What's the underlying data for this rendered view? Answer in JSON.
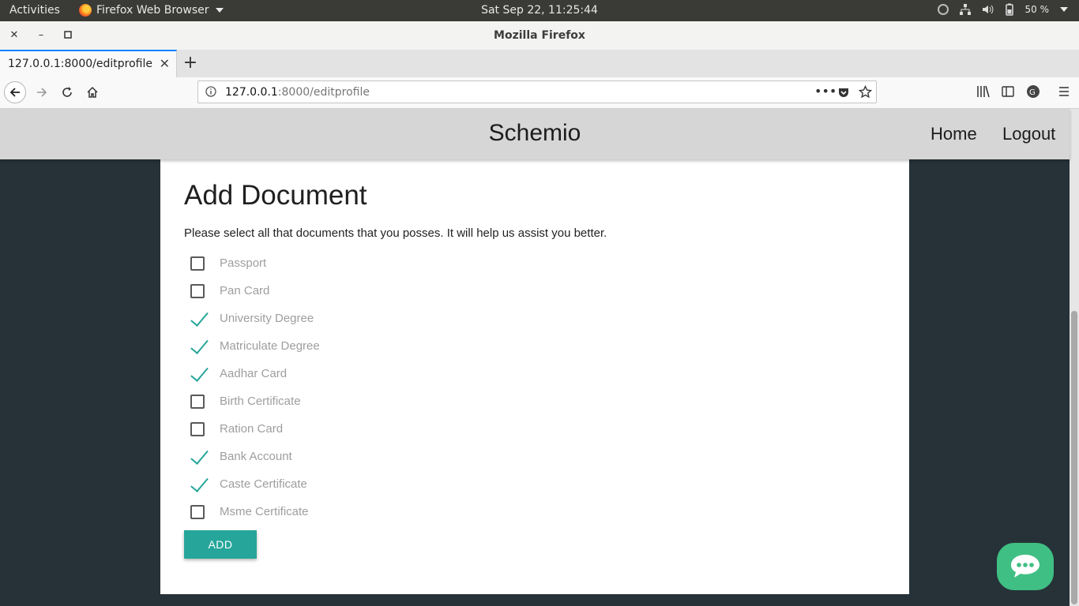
{
  "system_bar": {
    "activities": "Activities",
    "app_name": "Firefox Web Browser",
    "clock": "Sat Sep 22, 11:25:44",
    "battery": "50 %"
  },
  "window": {
    "title": "Mozilla Firefox"
  },
  "tab": {
    "title": "127.0.0.1:8000/editprofile"
  },
  "urlbar": {
    "host": "127.0.0.1",
    "path": ":8000/editprofile"
  },
  "site": {
    "brand": "Schemio",
    "nav": {
      "home": "Home",
      "logout": "Logout"
    }
  },
  "form": {
    "heading": "Add Document",
    "subtitle": "Please select all that documents that you posses. It will help us assist you better.",
    "documents": [
      {
        "label": "Passport",
        "checked": false
      },
      {
        "label": "Pan Card",
        "checked": false
      },
      {
        "label": "University Degree",
        "checked": true
      },
      {
        "label": "Matriculate Degree",
        "checked": true
      },
      {
        "label": "Aadhar Card",
        "checked": true
      },
      {
        "label": "Birth Certificate",
        "checked": false
      },
      {
        "label": "Ration Card",
        "checked": false
      },
      {
        "label": "Bank Account",
        "checked": true
      },
      {
        "label": "Caste Certificate",
        "checked": true
      },
      {
        "label": "Msme Certificate",
        "checked": false
      }
    ],
    "submit_label": "ADD"
  },
  "colors": {
    "accent": "#26a69a",
    "page_bg": "#263238",
    "header_bg": "#d6d6d6",
    "chat_fab": "#3fbf83"
  }
}
